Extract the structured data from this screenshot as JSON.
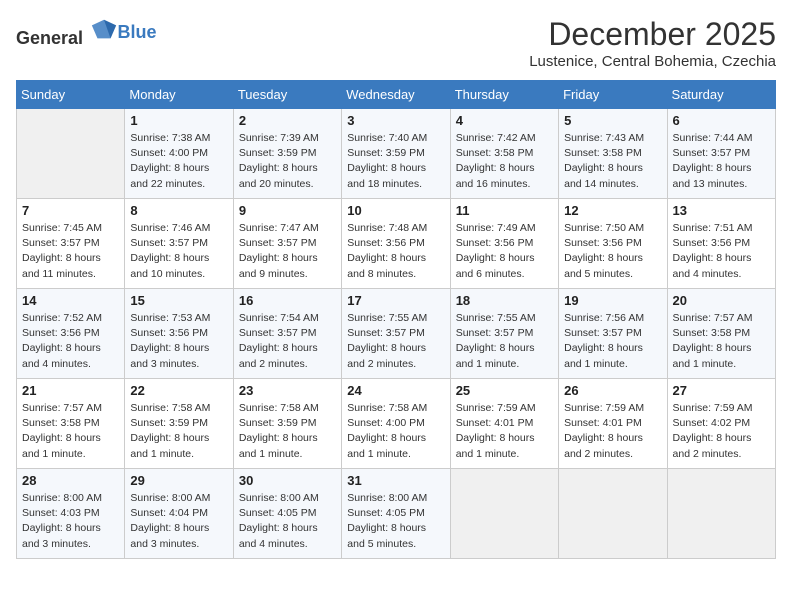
{
  "logo": {
    "general": "General",
    "blue": "Blue"
  },
  "header": {
    "month": "December 2025",
    "location": "Lustenice, Central Bohemia, Czechia"
  },
  "days_of_week": [
    "Sunday",
    "Monday",
    "Tuesday",
    "Wednesday",
    "Thursday",
    "Friday",
    "Saturday"
  ],
  "weeks": [
    [
      {
        "day": "",
        "info": ""
      },
      {
        "day": "1",
        "info": "Sunrise: 7:38 AM\nSunset: 4:00 PM\nDaylight: 8 hours\nand 22 minutes."
      },
      {
        "day": "2",
        "info": "Sunrise: 7:39 AM\nSunset: 3:59 PM\nDaylight: 8 hours\nand 20 minutes."
      },
      {
        "day": "3",
        "info": "Sunrise: 7:40 AM\nSunset: 3:59 PM\nDaylight: 8 hours\nand 18 minutes."
      },
      {
        "day": "4",
        "info": "Sunrise: 7:42 AM\nSunset: 3:58 PM\nDaylight: 8 hours\nand 16 minutes."
      },
      {
        "day": "5",
        "info": "Sunrise: 7:43 AM\nSunset: 3:58 PM\nDaylight: 8 hours\nand 14 minutes."
      },
      {
        "day": "6",
        "info": "Sunrise: 7:44 AM\nSunset: 3:57 PM\nDaylight: 8 hours\nand 13 minutes."
      }
    ],
    [
      {
        "day": "7",
        "info": "Sunrise: 7:45 AM\nSunset: 3:57 PM\nDaylight: 8 hours\nand 11 minutes."
      },
      {
        "day": "8",
        "info": "Sunrise: 7:46 AM\nSunset: 3:57 PM\nDaylight: 8 hours\nand 10 minutes."
      },
      {
        "day": "9",
        "info": "Sunrise: 7:47 AM\nSunset: 3:57 PM\nDaylight: 8 hours\nand 9 minutes."
      },
      {
        "day": "10",
        "info": "Sunrise: 7:48 AM\nSunset: 3:56 PM\nDaylight: 8 hours\nand 8 minutes."
      },
      {
        "day": "11",
        "info": "Sunrise: 7:49 AM\nSunset: 3:56 PM\nDaylight: 8 hours\nand 6 minutes."
      },
      {
        "day": "12",
        "info": "Sunrise: 7:50 AM\nSunset: 3:56 PM\nDaylight: 8 hours\nand 5 minutes."
      },
      {
        "day": "13",
        "info": "Sunrise: 7:51 AM\nSunset: 3:56 PM\nDaylight: 8 hours\nand 4 minutes."
      }
    ],
    [
      {
        "day": "14",
        "info": "Sunrise: 7:52 AM\nSunset: 3:56 PM\nDaylight: 8 hours\nand 4 minutes."
      },
      {
        "day": "15",
        "info": "Sunrise: 7:53 AM\nSunset: 3:56 PM\nDaylight: 8 hours\nand 3 minutes."
      },
      {
        "day": "16",
        "info": "Sunrise: 7:54 AM\nSunset: 3:57 PM\nDaylight: 8 hours\nand 2 minutes."
      },
      {
        "day": "17",
        "info": "Sunrise: 7:55 AM\nSunset: 3:57 PM\nDaylight: 8 hours\nand 2 minutes."
      },
      {
        "day": "18",
        "info": "Sunrise: 7:55 AM\nSunset: 3:57 PM\nDaylight: 8 hours\nand 1 minute."
      },
      {
        "day": "19",
        "info": "Sunrise: 7:56 AM\nSunset: 3:57 PM\nDaylight: 8 hours\nand 1 minute."
      },
      {
        "day": "20",
        "info": "Sunrise: 7:57 AM\nSunset: 3:58 PM\nDaylight: 8 hours\nand 1 minute."
      }
    ],
    [
      {
        "day": "21",
        "info": "Sunrise: 7:57 AM\nSunset: 3:58 PM\nDaylight: 8 hours\nand 1 minute."
      },
      {
        "day": "22",
        "info": "Sunrise: 7:58 AM\nSunset: 3:59 PM\nDaylight: 8 hours\nand 1 minute."
      },
      {
        "day": "23",
        "info": "Sunrise: 7:58 AM\nSunset: 3:59 PM\nDaylight: 8 hours\nand 1 minute."
      },
      {
        "day": "24",
        "info": "Sunrise: 7:58 AM\nSunset: 4:00 PM\nDaylight: 8 hours\nand 1 minute."
      },
      {
        "day": "25",
        "info": "Sunrise: 7:59 AM\nSunset: 4:01 PM\nDaylight: 8 hours\nand 1 minute."
      },
      {
        "day": "26",
        "info": "Sunrise: 7:59 AM\nSunset: 4:01 PM\nDaylight: 8 hours\nand 2 minutes."
      },
      {
        "day": "27",
        "info": "Sunrise: 7:59 AM\nSunset: 4:02 PM\nDaylight: 8 hours\nand 2 minutes."
      }
    ],
    [
      {
        "day": "28",
        "info": "Sunrise: 8:00 AM\nSunset: 4:03 PM\nDaylight: 8 hours\nand 3 minutes."
      },
      {
        "day": "29",
        "info": "Sunrise: 8:00 AM\nSunset: 4:04 PM\nDaylight: 8 hours\nand 3 minutes."
      },
      {
        "day": "30",
        "info": "Sunrise: 8:00 AM\nSunset: 4:05 PM\nDaylight: 8 hours\nand 4 minutes."
      },
      {
        "day": "31",
        "info": "Sunrise: 8:00 AM\nSunset: 4:05 PM\nDaylight: 8 hours\nand 5 minutes."
      },
      {
        "day": "",
        "info": ""
      },
      {
        "day": "",
        "info": ""
      },
      {
        "day": "",
        "info": ""
      }
    ]
  ]
}
